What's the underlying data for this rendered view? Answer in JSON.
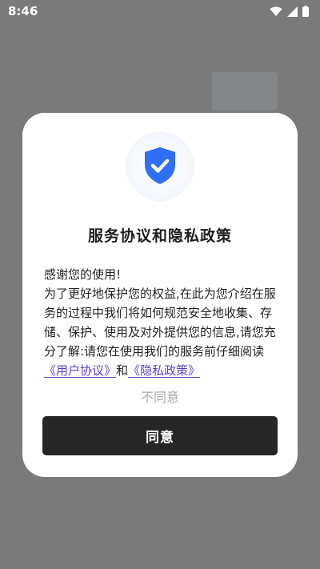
{
  "status_bar": {
    "time": "8:46",
    "icons": [
      "wifi-icon",
      "signal-icon",
      "battery-icon"
    ]
  },
  "dialog": {
    "title": "服务协议和隐私政策",
    "shield_icon": "shield-check-icon",
    "greeting": "感谢您的使用!",
    "paragraph": "为了更好地保护您的权益,在此为您介绍在服务的过程中我们将如何规范安全地收集、存储、保护、使用及对外提供您的信息,请您充分了解:请您在使用我们的服务前仔细阅读",
    "user_agreement_link": "《用户协议》",
    "conjunction": "和",
    "privacy_policy_link": "《隐私政策》",
    "disagree_label": "不同意",
    "agree_label": "同意"
  },
  "colors": {
    "overlay": "#7a7a7a",
    "link": "#5b3fc9",
    "agree_button": "#262626",
    "shield": "#2f6ff2",
    "disagree_text": "#a9a9a9"
  }
}
